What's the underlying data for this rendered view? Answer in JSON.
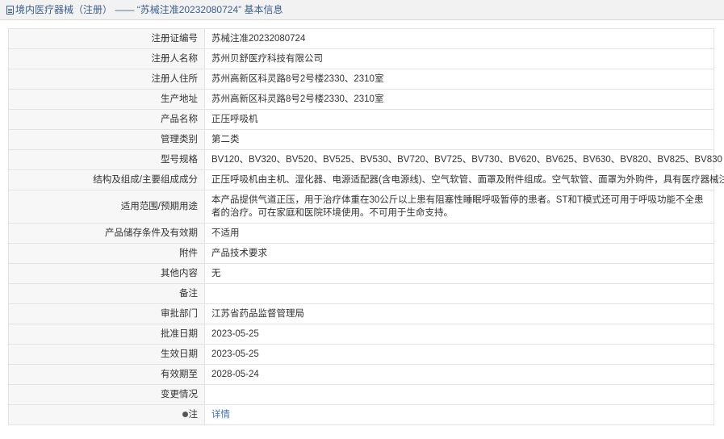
{
  "header": {
    "breadcrumb_icon": "document-icon",
    "section": "境内医疗器械（注册）",
    "separator": "——",
    "title": "“苏械注准20232080724” 基本信息"
  },
  "rows": [
    {
      "label": "注册证编号",
      "value": "苏械注准20232080724"
    },
    {
      "label": "注册人名称",
      "value": "苏州贝舒医疗科技有限公司"
    },
    {
      "label": "注册人住所",
      "value": "苏州高新区科灵路8号2号楼2330、2310室"
    },
    {
      "label": "生产地址",
      "value": "苏州高新区科灵路8号2号楼2330、2310室"
    },
    {
      "label": "产品名称",
      "value": "正压呼吸机"
    },
    {
      "label": "管理类别",
      "value": "第二类"
    },
    {
      "label": "型号规格",
      "value": "BV120、BV320、BV520、BV525、BV530、BV720、BV725、BV730、BV620、BV625、BV630、BV820、BV825、BV830"
    },
    {
      "label": "结构及组成/主要组成成分",
      "value": "正压呼吸机由主机、湿化器、电源适配器(含电源线)、空气软管、面罩及附件组成。空气软管、面罩为外购件，具有医疗器械注册证。"
    },
    {
      "label": "适用范围/预期用途",
      "value": "本产品提供气道正压，用于治疗体重在30公斤以上患有阻塞性睡眠呼吸暂停的患者。ST和T模式还可用于呼吸功能不全患者的治疗。可在家庭和医院环境使用。不可用于生命支持。"
    },
    {
      "label": "产品储存条件及有效期",
      "value": "不适用"
    },
    {
      "label": "附件",
      "value": "产品技术要求"
    },
    {
      "label": "其他内容",
      "value": "无"
    },
    {
      "label": "备注",
      "value": ""
    },
    {
      "label": "审批部门",
      "value": "江苏省药品监督管理局"
    },
    {
      "label": "批准日期",
      "value": "2023-05-25"
    },
    {
      "label": "生效日期",
      "value": "2023-05-25"
    },
    {
      "label": "有效期至",
      "value": "2028-05-24"
    },
    {
      "label": "变更情况",
      "value": ""
    }
  ],
  "note_row": {
    "icon": "bullet-icon",
    "label": "注",
    "link": "详情"
  }
}
